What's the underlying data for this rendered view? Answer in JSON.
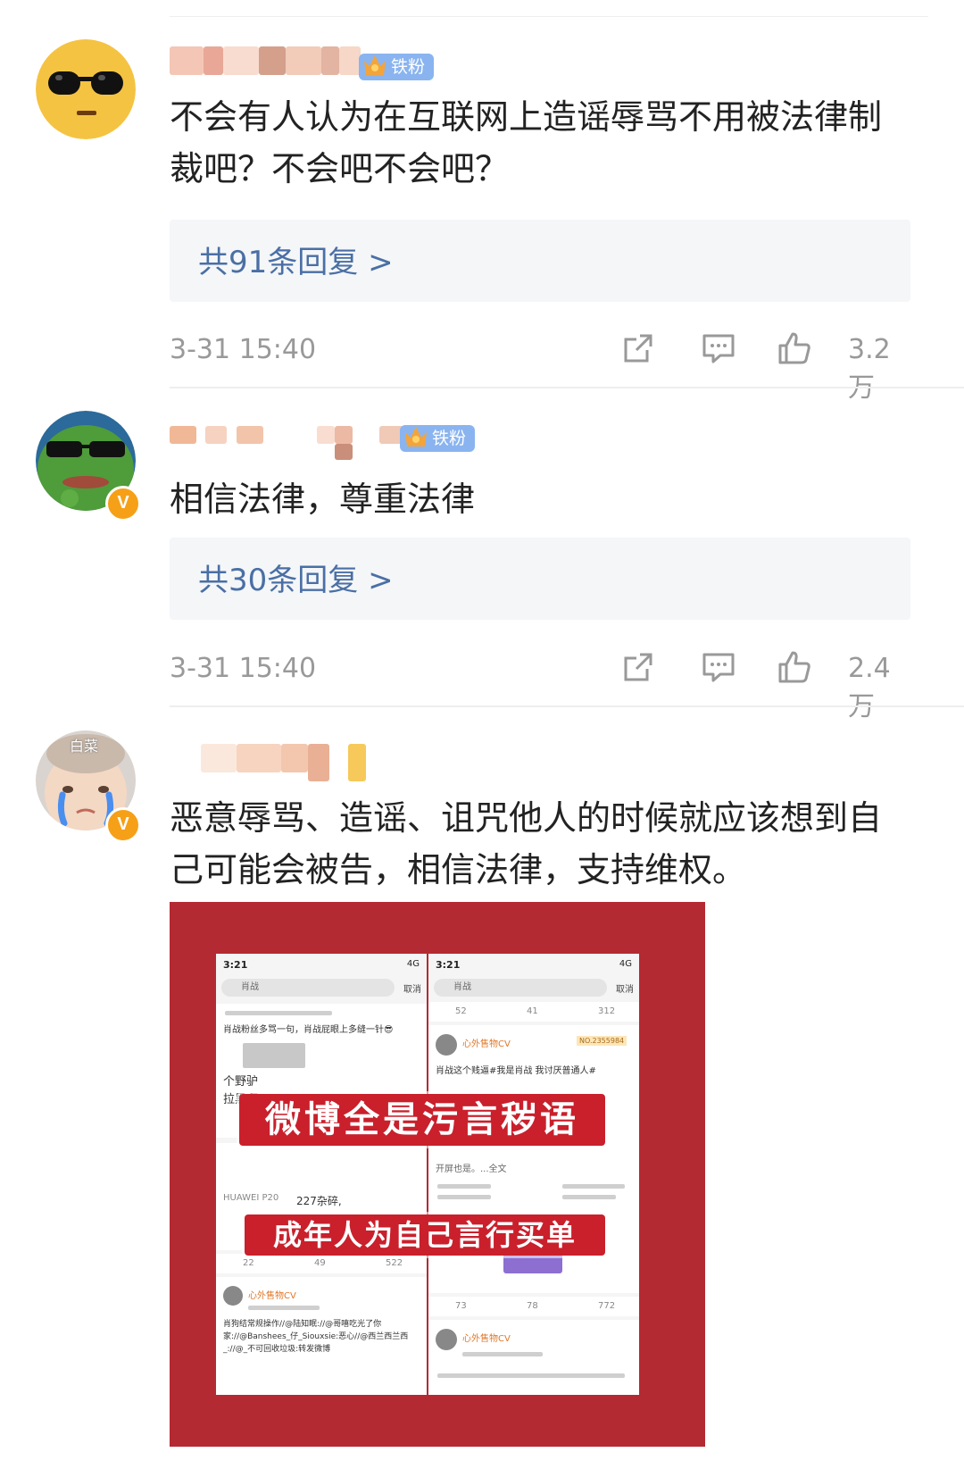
{
  "comments": [
    {
      "badge": "铁粉",
      "text": "不会有人认为在互联网上造谣辱骂不用被法律制裁吧？不会吧不会吧？",
      "replies": "共91条回复 >",
      "time": "3-31 15:40",
      "likes": "3.2万"
    },
    {
      "badge": "铁粉",
      "text": "相信法律，尊重法律",
      "replies": "共30条回复 >",
      "time": "3-31 15:40",
      "likes": "2.4万"
    },
    {
      "avatar_caption": "白菜",
      "text": "恶意辱骂、造谣、诅咒他人的时候就应该想到自己可能会被告，相信法律，支持维权。"
    }
  ],
  "image": {
    "banner_top": "微博全是污言秽语",
    "banner_bottom": "成年人为自己言行买单",
    "left_phone": {
      "status_time": "3:21",
      "status_net": "4G",
      "search": "肖战",
      "cancel": "取消",
      "line1": "肖战粉丝多骂一句，肖战屁眼上多缝一针😎",
      "line2": "个野驴",
      "line3": "拉黑啊？",
      "device": "HUAWEI P20",
      "line4": "227杂碎,",
      "counts": [
        "22",
        "49",
        "522"
      ],
      "user": "心外售物CV",
      "body": "肖狗结常规操作//@陆知眠://@哥嘻吃光了你家://@Banshees_仔_Siouxsie:恶心//@西兰西兰西_://@_不可回收垃圾:转发微博"
    },
    "right_phone": {
      "status_time": "3:21",
      "status_net": "4G",
      "search": "肖战",
      "cancel": "取消",
      "top_counts": [
        "52",
        "41",
        "312"
      ],
      "user": "心外售物CV",
      "tag": "NO.2355984",
      "body": "肖战这个贱逼#我是肖战 我讨厌普通人#",
      "more": "开屏也是。...全文",
      "counts": [
        "73",
        "78",
        "772"
      ],
      "user2": "心外售物CV"
    }
  },
  "colors": {
    "link_blue": "#4a6fa5",
    "badge_blue": "#8ab4f0",
    "verified_orange": "#f6a018",
    "image_red": "#b42a32"
  }
}
